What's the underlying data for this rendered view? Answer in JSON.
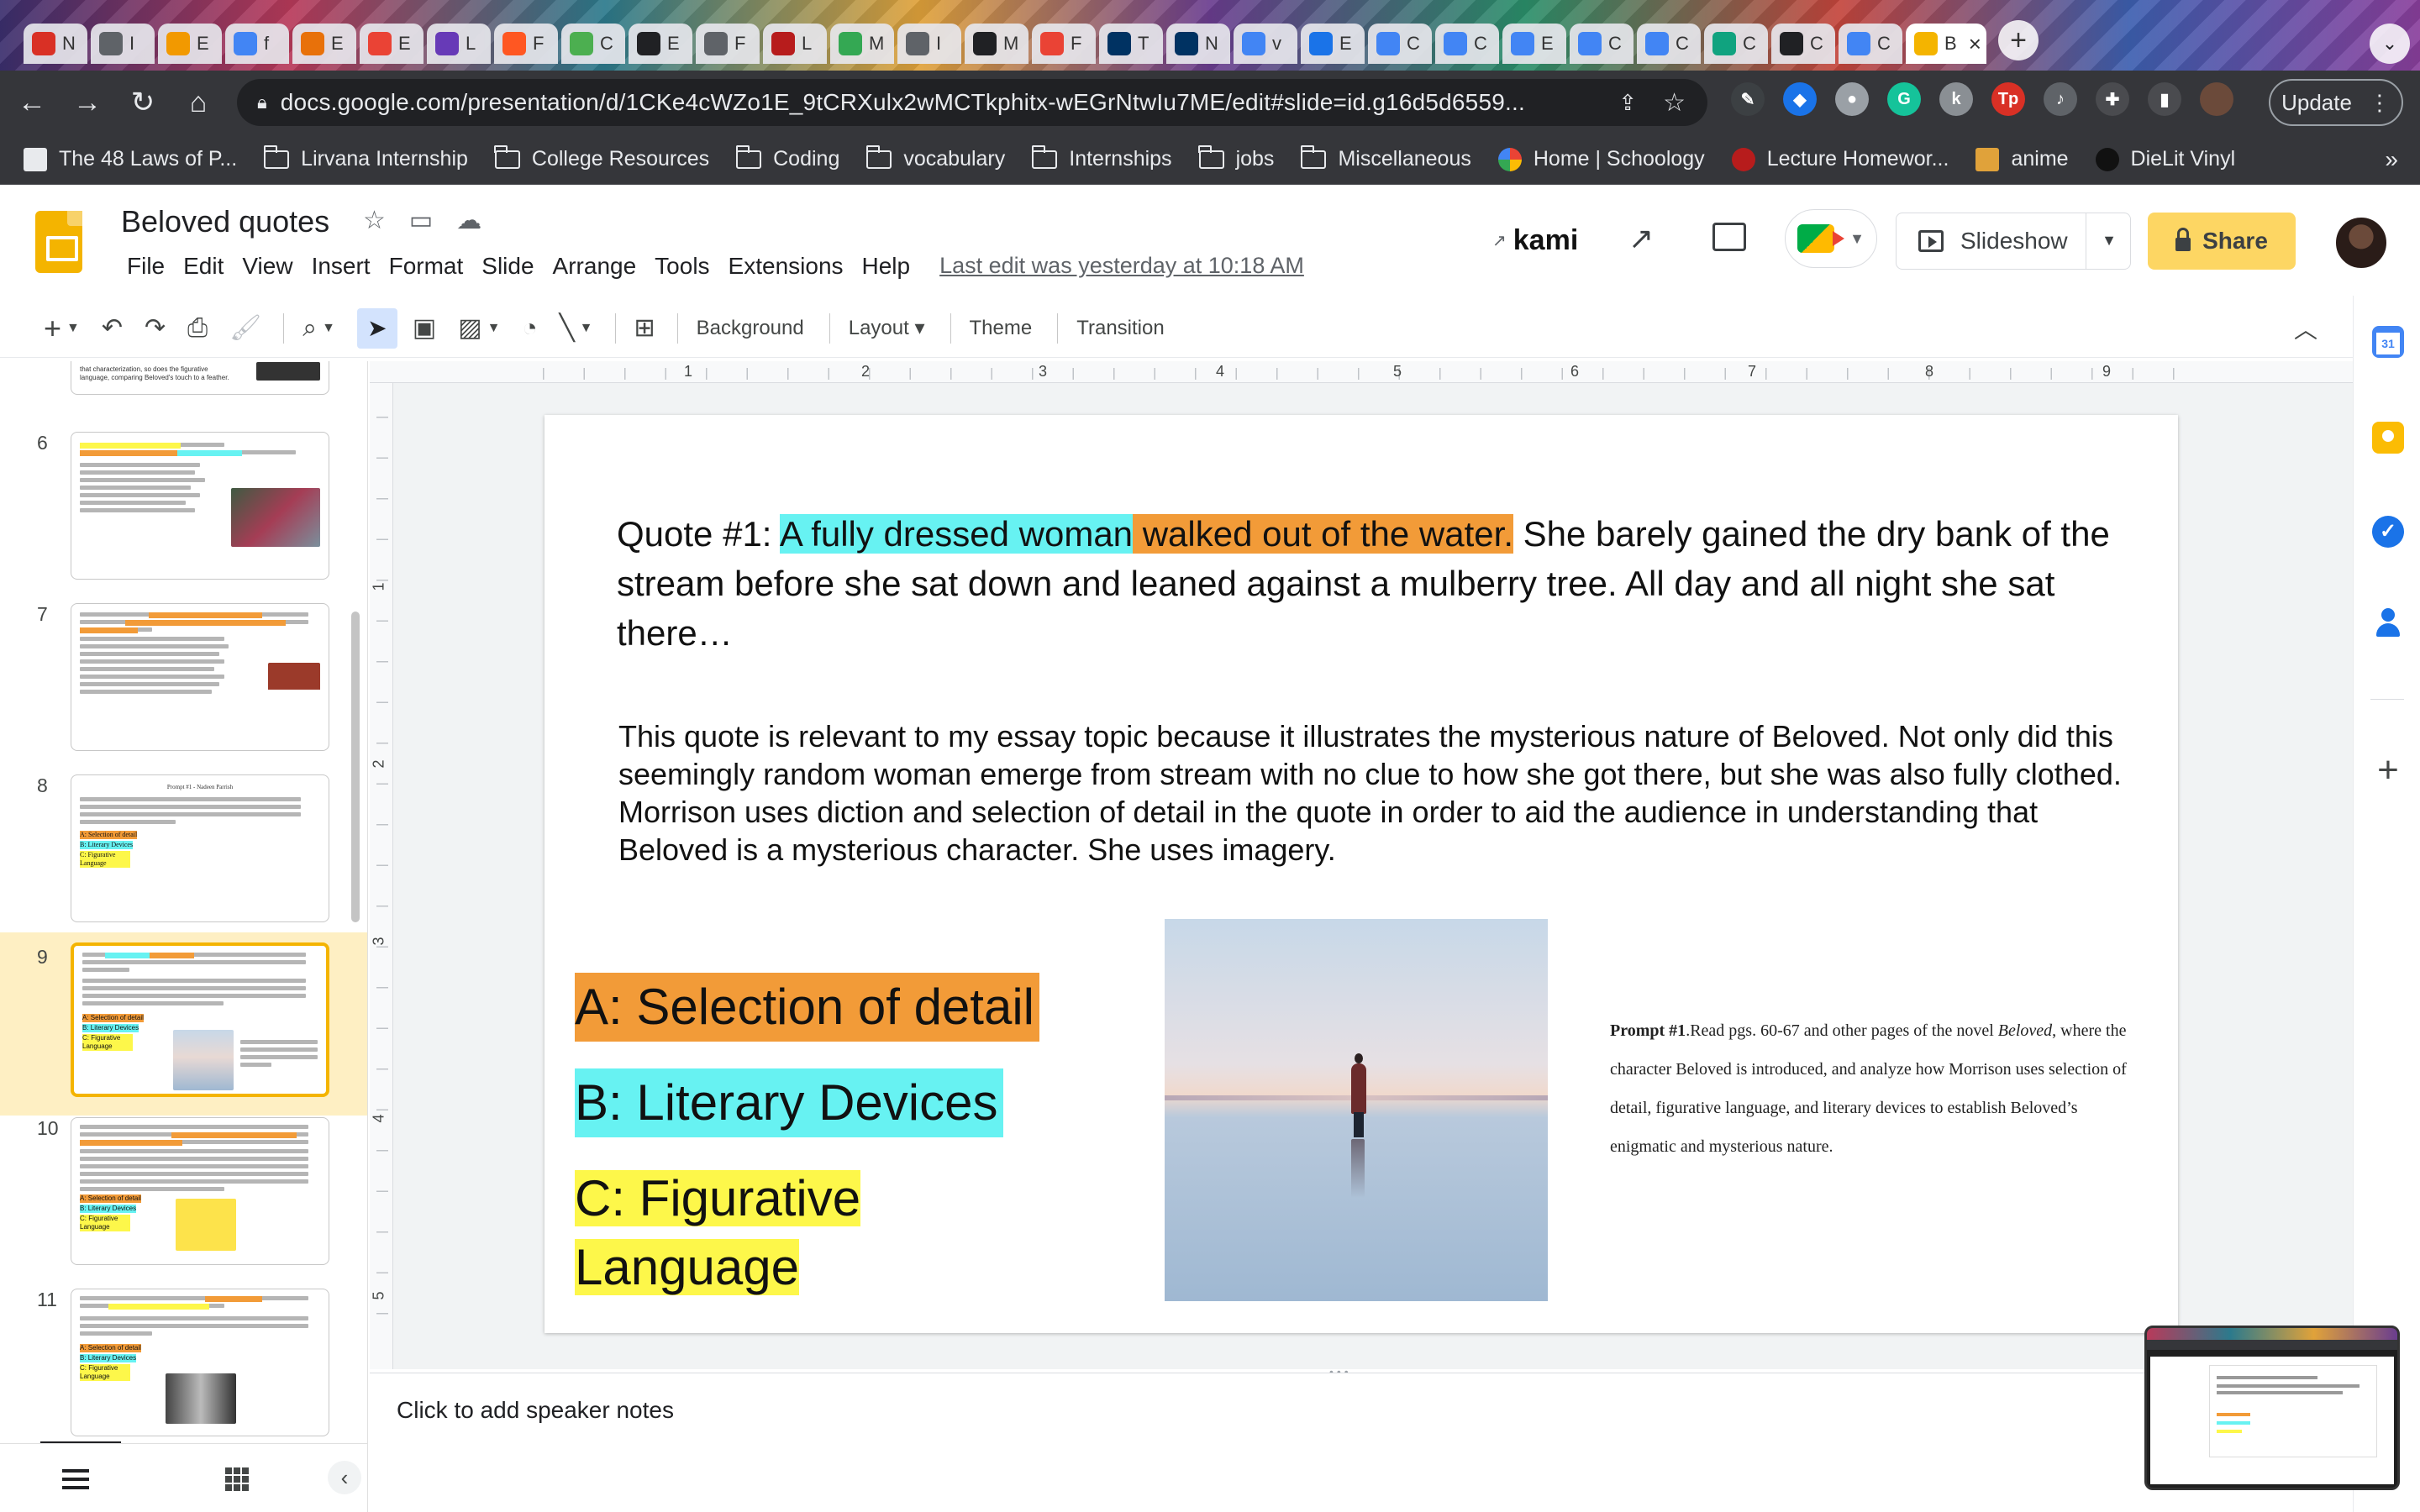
{
  "browser": {
    "tabs": [
      {
        "letter": "N",
        "color": "#d93025"
      },
      {
        "letter": "I",
        "color": "#5f6368"
      },
      {
        "letter": "E",
        "color": "#f29900"
      },
      {
        "letter": "f",
        "color": "#4285f4"
      },
      {
        "letter": "E",
        "color": "#e8710a"
      },
      {
        "letter": "E",
        "color": "#ea4335"
      },
      {
        "letter": "L",
        "color": "#673ab7"
      },
      {
        "letter": "F",
        "color": "#ff5722"
      },
      {
        "letter": "C",
        "color": "#4caf50"
      },
      {
        "letter": "E",
        "color": "#202124"
      },
      {
        "letter": "F",
        "color": "#5f6368"
      },
      {
        "letter": "L",
        "color": "#b71c1c"
      },
      {
        "letter": "M",
        "color": "#34a853"
      },
      {
        "letter": "I",
        "color": "#5f6368"
      },
      {
        "letter": "M",
        "color": "#202124"
      },
      {
        "letter": "F",
        "color": "#ea4335"
      },
      {
        "letter": "T",
        "color": "#003262"
      },
      {
        "letter": "N",
        "color": "#003262"
      },
      {
        "letter": "v",
        "color": "#4285f4"
      },
      {
        "letter": "E",
        "color": "#1a73e8"
      },
      {
        "letter": "C",
        "color": "#4285f4"
      },
      {
        "letter": "C",
        "color": "#4285f4"
      },
      {
        "letter": "E",
        "color": "#4285f4"
      },
      {
        "letter": "C",
        "color": "#4285f4"
      },
      {
        "letter": "C",
        "color": "#4285f4"
      },
      {
        "letter": "C",
        "color": "#10a37f"
      },
      {
        "letter": "C",
        "color": "#202124"
      },
      {
        "letter": "C",
        "color": "#4285f4"
      },
      {
        "letter": "B",
        "color": "#f4b400"
      }
    ],
    "url": "docs.google.com/presentation/d/1CKe4cWZo1E_9tCRXulx2wMCTkphitx-wEGrNtwIu7ME/edit#slide=id.g16d5d6559...",
    "update_label": "Update",
    "bookmarks": [
      {
        "label": "The 48 Laws of P...",
        "icon": "bank-icon"
      },
      {
        "label": "Lirvana Internship",
        "icon": "folder-icon"
      },
      {
        "label": "College Resources",
        "icon": "folder-icon"
      },
      {
        "label": "Coding",
        "icon": "folder-icon"
      },
      {
        "label": "vocabulary",
        "icon": "folder-icon"
      },
      {
        "label": "Internships",
        "icon": "folder-icon"
      },
      {
        "label": "jobs",
        "icon": "folder-icon"
      },
      {
        "label": "Miscellaneous",
        "icon": "folder-icon"
      },
      {
        "label": "Home | Schoology",
        "icon": "google-icon"
      },
      {
        "label": "Lecture Homewor...",
        "icon": "gear-icon"
      },
      {
        "label": "anime",
        "icon": "image-icon"
      },
      {
        "label": "DieLit Vinyl",
        "icon": "vinyl-icon"
      }
    ]
  },
  "app": {
    "title": "Beloved quotes",
    "menu": [
      "File",
      "Edit",
      "View",
      "Insert",
      "Format",
      "Slide",
      "Arrange",
      "Tools",
      "Extensions",
      "Help"
    ],
    "last_edit": "Last edit was yesterday at 10:18 AM",
    "kami": "kami",
    "slideshow_label": "Slideshow",
    "share_label": "Share",
    "accent": "#fdd663"
  },
  "toolbar": {
    "background": "Background",
    "layout": "Layout",
    "theme": "Theme",
    "transition": "Transition"
  },
  "ruler": {
    "h_ticks": [
      "1",
      "2",
      "3",
      "4",
      "5",
      "6",
      "7",
      "8",
      "9"
    ],
    "v_ticks": [
      "1",
      "2",
      "3",
      "4",
      "5"
    ]
  },
  "filmstrip": {
    "numbers": [
      "6",
      "7",
      "8",
      "9",
      "10",
      "11"
    ],
    "selected": "9",
    "thumb8_title": "Prompt #1 - Nadeen Parrish",
    "thumb_labels": {
      "a": "A: Selection of detail",
      "b": "B: Literary Devices",
      "c": "C: Figurative Language"
    },
    "thumb_partial_text": "that characterization, so does the figurative language, comparing Beloved's touch to a feather."
  },
  "slide": {
    "quote_prefix": "Quote #1: ",
    "quote_hl_cyan": "A fully dressed woman",
    "quote_hl_orange": " walked out of the water.",
    "quote_rest": " She barely gained the dry bank of the stream before she sat down and leaned against a mulberry tree. All day and all night she sat there…",
    "body": "This quote is relevant to my essay topic because it illustrates the mysterious nature of Beloved. Not only did this seemingly random woman emerge from stream with no clue to how she got there, but she was also fully clothed. Morrison uses diction and selection of detail in the quote in order to aid the audience in understanding that Beloved is a mysterious character. She uses imagery.",
    "label_a": "A: Selection of detail",
    "label_b": "B: Literary Devices",
    "label_c": "C: Figurative Language",
    "prompt_bold": "Prompt #1",
    "prompt_1": ".Read pgs. 60-67 and other pages of the novel ",
    "prompt_italic": "Beloved",
    "prompt_2": ", where the character Beloved is introduced, and analyze how Morrison uses selection of detail, figurative language, and literary devices to establish Beloved’s enigmatic and mysterious nature.",
    "colors": {
      "orange": "#f29b38",
      "cyan": "#67f2f2",
      "yellow": "#fdf74a"
    }
  },
  "notes": {
    "placeholder": "Click to add speaker notes"
  }
}
